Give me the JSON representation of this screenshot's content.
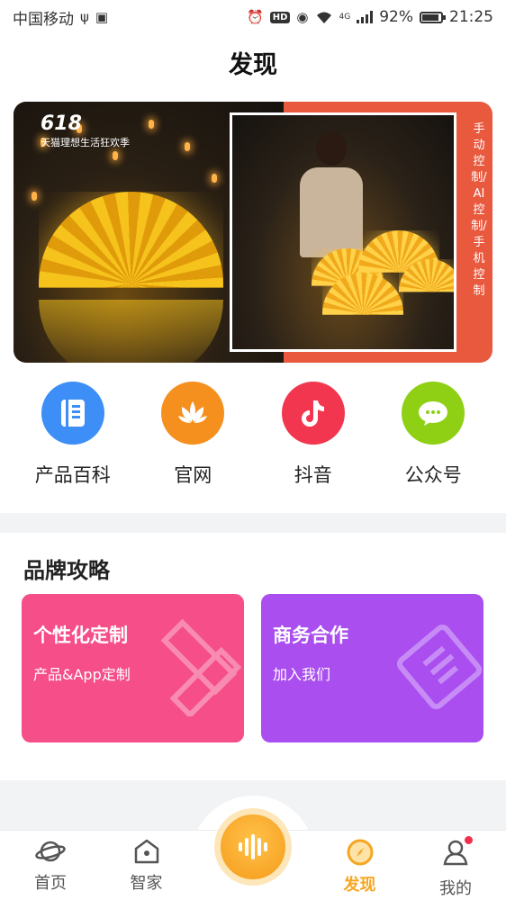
{
  "status_bar": {
    "carrier": "中国移动",
    "network": "4G",
    "battery": "92%",
    "time": "21:25"
  },
  "header": {
    "title": "发现"
  },
  "banner": {
    "logo_number": "618",
    "logo_text": "天猫理想生活狂欢季",
    "vertical_text": "手动控制/AI控制/手机控制"
  },
  "quick_links": [
    {
      "label": "产品百科",
      "icon": "book-icon",
      "color": "#3d8ef6"
    },
    {
      "label": "官网",
      "icon": "lotus-icon",
      "color": "#f5901e"
    },
    {
      "label": "抖音",
      "icon": "tiktok-icon",
      "color": "#f2364f"
    },
    {
      "label": "公众号",
      "icon": "wechat-icon",
      "color": "#8fd014"
    }
  ],
  "brand_section": {
    "title": "品牌攻略",
    "cards": [
      {
        "title": "个性化定制",
        "subtitle": "产品&App定制",
        "color": "#f54e88",
        "icon": "pencil-ruler-icon"
      },
      {
        "title": "商务合作",
        "subtitle": "加入我们",
        "color": "#aa4ef0",
        "icon": "handshake-icon"
      }
    ]
  },
  "tab_bar": {
    "items": [
      {
        "label": "首页",
        "icon": "planet-icon",
        "active": false
      },
      {
        "label": "智家",
        "icon": "smart-home-icon",
        "active": false
      },
      {
        "label": "",
        "icon": "voice-icon",
        "active": false
      },
      {
        "label": "发现",
        "icon": "compass-icon",
        "active": true
      },
      {
        "label": "我的",
        "icon": "profile-icon",
        "active": false
      }
    ],
    "active_color": "#f5a623"
  }
}
